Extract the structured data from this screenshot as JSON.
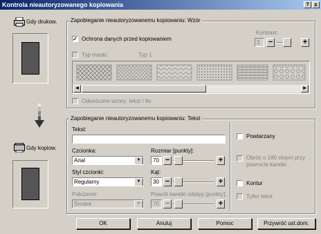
{
  "window": {
    "title": "Kontrola nieautoryzowanego kopiowania",
    "help_btn": "?",
    "close_btn": "x"
  },
  "left": {
    "when_printing": "Gdy drukow.",
    "when_copying": "Gdy kopiow."
  },
  "pattern_group": {
    "legend": "Zapobieganie nieautoryzowanemu kopiowaniu: Wzór",
    "protect_label": "Ochrona danych przed kopiowaniem",
    "protect_checked": true,
    "contrast_label": "Kontrast:",
    "contrast_value": "3",
    "mask_type_label": "Typ maski:",
    "mask_type_value": "Typ 1",
    "inverted_label": "Odwrócone wzory: tekst / tło"
  },
  "text_group": {
    "legend": "Zapobieganie nieautoryzowanemu kopiowaniu: Tekst",
    "text_label": "Tekst:",
    "text_value": "",
    "font_label": "Czcionka:",
    "font_value": "Arial",
    "size_label": "Rozmiar [punkty]:",
    "size_value": "70",
    "style_label": "Styl czcionki:",
    "style_value": "Regularny",
    "angle_label": "Kąt:",
    "angle_value": "30",
    "position_label": "Położenie:",
    "position_value": "Środek",
    "spacing_label": "Powrót karetki odstęp [punkty]:",
    "spacing_value": "70",
    "repeat_label": "Powtarzany",
    "rotate_label": "Obróć o 180 stopni przy powrocie karetki",
    "outline_label": "Kontur",
    "text_only_label": "Tylko tekst"
  },
  "buttons": {
    "ok": "OK",
    "cancel": "Anuluj",
    "help": "Pomoc",
    "restore": "Przywróć ust.dom."
  },
  "colors": {
    "title_start": "#0a246a",
    "title_end": "#a6caf0",
    "preview": "#555555"
  }
}
